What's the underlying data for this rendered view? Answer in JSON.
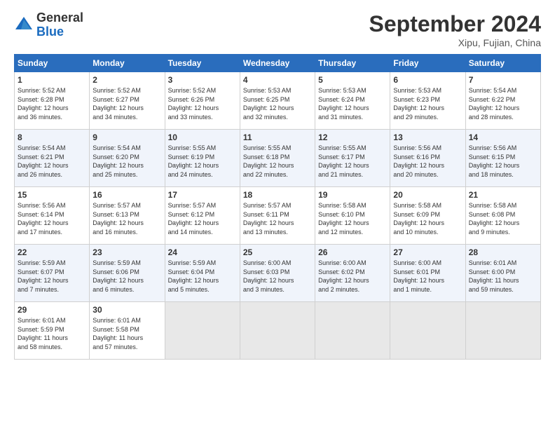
{
  "logo": {
    "general": "General",
    "blue": "Blue"
  },
  "header": {
    "month": "September 2024",
    "location": "Xipu, Fujian, China"
  },
  "weekdays": [
    "Sunday",
    "Monday",
    "Tuesday",
    "Wednesday",
    "Thursday",
    "Friday",
    "Saturday"
  ],
  "weeks": [
    [
      {
        "day": "1",
        "info": "Sunrise: 5:52 AM\nSunset: 6:28 PM\nDaylight: 12 hours\nand 36 minutes."
      },
      {
        "day": "2",
        "info": "Sunrise: 5:52 AM\nSunset: 6:27 PM\nDaylight: 12 hours\nand 34 minutes."
      },
      {
        "day": "3",
        "info": "Sunrise: 5:52 AM\nSunset: 6:26 PM\nDaylight: 12 hours\nand 33 minutes."
      },
      {
        "day": "4",
        "info": "Sunrise: 5:53 AM\nSunset: 6:25 PM\nDaylight: 12 hours\nand 32 minutes."
      },
      {
        "day": "5",
        "info": "Sunrise: 5:53 AM\nSunset: 6:24 PM\nDaylight: 12 hours\nand 31 minutes."
      },
      {
        "day": "6",
        "info": "Sunrise: 5:53 AM\nSunset: 6:23 PM\nDaylight: 12 hours\nand 29 minutes."
      },
      {
        "day": "7",
        "info": "Sunrise: 5:54 AM\nSunset: 6:22 PM\nDaylight: 12 hours\nand 28 minutes."
      }
    ],
    [
      {
        "day": "8",
        "info": "Sunrise: 5:54 AM\nSunset: 6:21 PM\nDaylight: 12 hours\nand 26 minutes."
      },
      {
        "day": "9",
        "info": "Sunrise: 5:54 AM\nSunset: 6:20 PM\nDaylight: 12 hours\nand 25 minutes."
      },
      {
        "day": "10",
        "info": "Sunrise: 5:55 AM\nSunset: 6:19 PM\nDaylight: 12 hours\nand 24 minutes."
      },
      {
        "day": "11",
        "info": "Sunrise: 5:55 AM\nSunset: 6:18 PM\nDaylight: 12 hours\nand 22 minutes."
      },
      {
        "day": "12",
        "info": "Sunrise: 5:55 AM\nSunset: 6:17 PM\nDaylight: 12 hours\nand 21 minutes."
      },
      {
        "day": "13",
        "info": "Sunrise: 5:56 AM\nSunset: 6:16 PM\nDaylight: 12 hours\nand 20 minutes."
      },
      {
        "day": "14",
        "info": "Sunrise: 5:56 AM\nSunset: 6:15 PM\nDaylight: 12 hours\nand 18 minutes."
      }
    ],
    [
      {
        "day": "15",
        "info": "Sunrise: 5:56 AM\nSunset: 6:14 PM\nDaylight: 12 hours\nand 17 minutes."
      },
      {
        "day": "16",
        "info": "Sunrise: 5:57 AM\nSunset: 6:13 PM\nDaylight: 12 hours\nand 16 minutes."
      },
      {
        "day": "17",
        "info": "Sunrise: 5:57 AM\nSunset: 6:12 PM\nDaylight: 12 hours\nand 14 minutes."
      },
      {
        "day": "18",
        "info": "Sunrise: 5:57 AM\nSunset: 6:11 PM\nDaylight: 12 hours\nand 13 minutes."
      },
      {
        "day": "19",
        "info": "Sunrise: 5:58 AM\nSunset: 6:10 PM\nDaylight: 12 hours\nand 12 minutes."
      },
      {
        "day": "20",
        "info": "Sunrise: 5:58 AM\nSunset: 6:09 PM\nDaylight: 12 hours\nand 10 minutes."
      },
      {
        "day": "21",
        "info": "Sunrise: 5:58 AM\nSunset: 6:08 PM\nDaylight: 12 hours\nand 9 minutes."
      }
    ],
    [
      {
        "day": "22",
        "info": "Sunrise: 5:59 AM\nSunset: 6:07 PM\nDaylight: 12 hours\nand 7 minutes."
      },
      {
        "day": "23",
        "info": "Sunrise: 5:59 AM\nSunset: 6:06 PM\nDaylight: 12 hours\nand 6 minutes."
      },
      {
        "day": "24",
        "info": "Sunrise: 5:59 AM\nSunset: 6:04 PM\nDaylight: 12 hours\nand 5 minutes."
      },
      {
        "day": "25",
        "info": "Sunrise: 6:00 AM\nSunset: 6:03 PM\nDaylight: 12 hours\nand 3 minutes."
      },
      {
        "day": "26",
        "info": "Sunrise: 6:00 AM\nSunset: 6:02 PM\nDaylight: 12 hours\nand 2 minutes."
      },
      {
        "day": "27",
        "info": "Sunrise: 6:00 AM\nSunset: 6:01 PM\nDaylight: 12 hours\nand 1 minute."
      },
      {
        "day": "28",
        "info": "Sunrise: 6:01 AM\nSunset: 6:00 PM\nDaylight: 11 hours\nand 59 minutes."
      }
    ],
    [
      {
        "day": "29",
        "info": "Sunrise: 6:01 AM\nSunset: 5:59 PM\nDaylight: 11 hours\nand 58 minutes."
      },
      {
        "day": "30",
        "info": "Sunrise: 6:01 AM\nSunset: 5:58 PM\nDaylight: 11 hours\nand 57 minutes."
      },
      {
        "day": "",
        "info": ""
      },
      {
        "day": "",
        "info": ""
      },
      {
        "day": "",
        "info": ""
      },
      {
        "day": "",
        "info": ""
      },
      {
        "day": "",
        "info": ""
      }
    ]
  ]
}
